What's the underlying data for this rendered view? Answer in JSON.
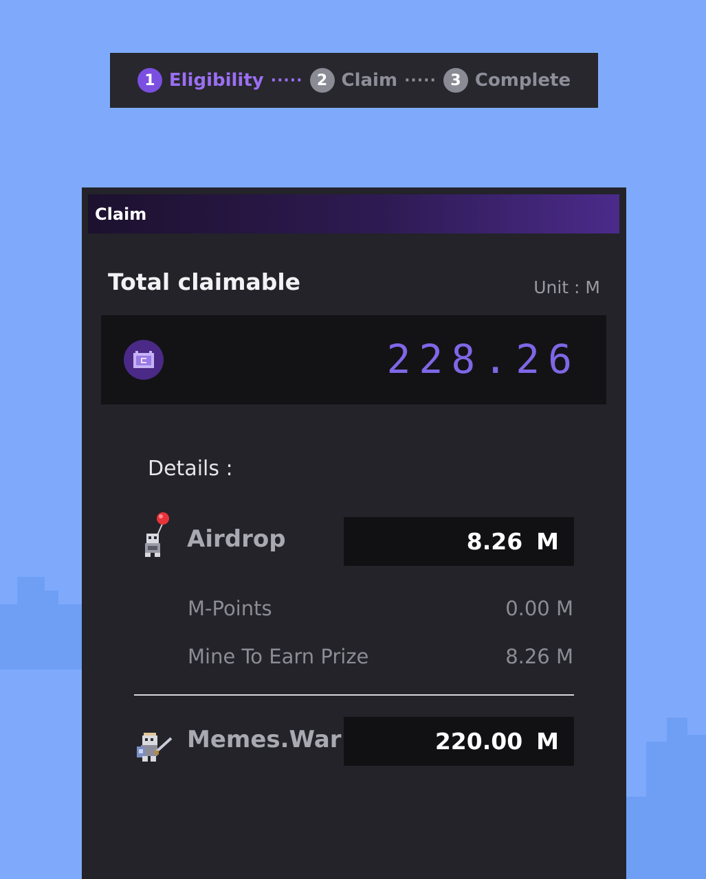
{
  "stepper": {
    "steps": [
      {
        "number": "1",
        "label": "Eligibility",
        "active": true
      },
      {
        "number": "2",
        "label": "Claim",
        "active": false
      },
      {
        "number": "3",
        "label": "Complete",
        "active": false
      }
    ],
    "separator": "·····"
  },
  "panel": {
    "title": "Claim",
    "total_label": "Total claimable",
    "unit_label": "Unit : M",
    "total_value": "228.26",
    "coin_icon": "coin-icon",
    "details_label": "Details :",
    "airdrop": {
      "name": "Airdrop",
      "icon": "balloon-character-icon",
      "value": "8.26",
      "unit": "M",
      "items": [
        {
          "label": "M-Points",
          "value": "0.00 M"
        },
        {
          "label": "Mine To Earn Prize",
          "value": "8.26 M"
        }
      ]
    },
    "memes_war": {
      "name": "Memes.War",
      "icon": "knight-character-icon",
      "value": "220.00",
      "unit": "M"
    }
  },
  "colors": {
    "background": "#7faafc",
    "panel": "#232329",
    "accent": "#7b4fe0",
    "total_value": "#7f67e6"
  }
}
